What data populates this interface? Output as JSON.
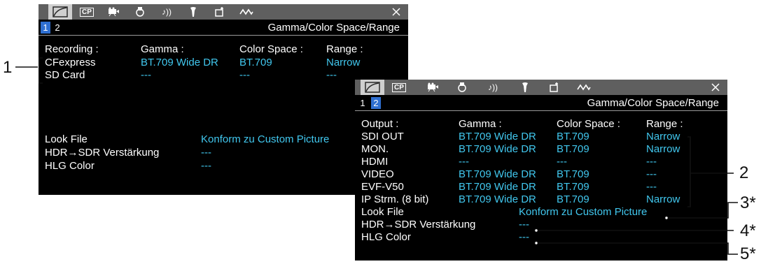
{
  "colors": {
    "accent": "#41c7ee",
    "page_active": "#2f6fd1",
    "tab_bar": "#5f5f5f"
  },
  "tab_icons": [
    "gamma-curve-icon",
    "custom-picture-icon",
    "camera-icon",
    "recording-media-icon",
    "audio-icon",
    "settings-wrench-icon",
    "assist-icon",
    "waveform-icon"
  ],
  "screen1": {
    "tab_cp": "CP",
    "pages": [
      "1",
      "2"
    ],
    "active_page": "1",
    "title": "Gamma/Color Space/Range",
    "headers": {
      "col1": "Recording :",
      "col2": "Gamma :",
      "col3": "Color Space :",
      "col4": "Range :"
    },
    "rows": [
      {
        "name": "CFexpress",
        "gamma": "BT.709 Wide DR",
        "color_space": "BT.709",
        "range": "Narrow"
      },
      {
        "name": "SD Card",
        "gamma": "---",
        "color_space": "---",
        "range": "---"
      }
    ],
    "look_file": {
      "label": "Look File",
      "value": "Konform zu Custom Picture"
    },
    "hdr_sdr": {
      "label": "HDR→SDR Verstärkung",
      "value": "---"
    },
    "hlg_color": {
      "label": "HLG Color",
      "value": "---"
    }
  },
  "screen2": {
    "tab_cp": "CP",
    "pages": [
      "1",
      "2"
    ],
    "active_page": "2",
    "title": "Gamma/Color Space/Range",
    "headers": {
      "col1": "Output :",
      "col2": "Gamma :",
      "col3": "Color Space :",
      "col4": "Range :"
    },
    "rows": [
      {
        "name": "SDI OUT",
        "gamma": "BT.709 Wide DR",
        "color_space": "BT.709",
        "range": "Narrow"
      },
      {
        "name": "MON.",
        "gamma": "BT.709 Wide DR",
        "color_space": "BT.709",
        "range": "Narrow"
      },
      {
        "name": "HDMI",
        "gamma": "---",
        "color_space": "---",
        "range": "---"
      },
      {
        "name": "VIDEO",
        "gamma": "BT.709 Wide DR",
        "color_space": "BT.709",
        "range": "---"
      },
      {
        "name": "EVF-V50",
        "gamma": "BT.709 Wide DR",
        "color_space": "BT.709",
        "range": "---"
      },
      {
        "name": "IP Strm. (8 bit)",
        "gamma": "BT.709 Wide DR",
        "color_space": "BT.709",
        "range": "Narrow"
      }
    ],
    "look_file": {
      "label": "Look File",
      "value": "Konform zu Custom Picture"
    },
    "hdr_sdr": {
      "label": "HDR→SDR Verstärkung",
      "value": "---"
    },
    "hlg_color": {
      "label": "HLG Color",
      "value": "---"
    }
  },
  "annotations": {
    "a1": "1",
    "a2": "2",
    "a3": "3*",
    "a4": "4*",
    "a5": "5*"
  }
}
